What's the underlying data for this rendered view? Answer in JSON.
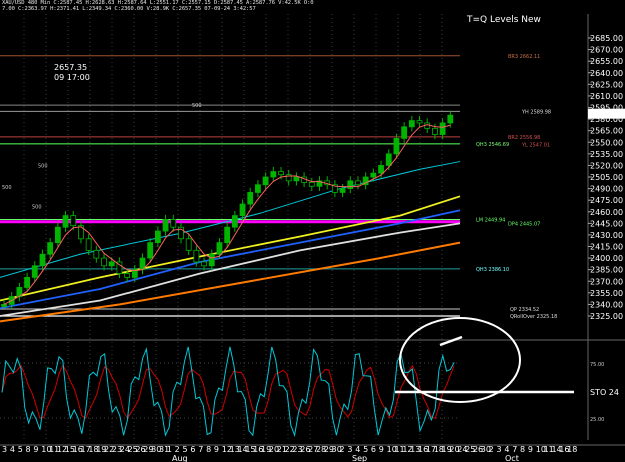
{
  "header": {
    "line1": "XAU/USD 480 Min  C:2587.45  H:2628.63  H:2587.64  L:2551.17  C:2557.15  D:2587.45  A:2587.76  V:42.5K  O:0",
    "line2": "7.00  C:2363.97  H:2371.41  L:2349.34  C:2360.00  V:28.9K  C:2657.35  07-09-24  3:42:57"
  },
  "chart_title": "T=Q Levels New",
  "info_box": {
    "price": "2657.35",
    "time": "09 17:00"
  },
  "current_price": "2587.41",
  "price_axis": [
    "2685.00",
    "2670.00",
    "2655.00",
    "2640.00",
    "2625.00",
    "2610.00",
    "2595.00",
    "2580.00",
    "2565.00",
    "2550.00",
    "2535.00",
    "2520.00",
    "2505.00",
    "2490.00",
    "2475.00",
    "2460.00",
    "2445.00",
    "2430.00",
    "2415.00",
    "2400.00",
    "2385.00",
    "2370.00",
    "2355.00",
    "2340.00",
    "2325.00"
  ],
  "level_labels": {
    "l1": "BR3 2662.11",
    "l2": "YH 2589.98",
    "l3": "BR2 2556.98",
    "l4": "QH3 2546.69",
    "l5": "YL 2547.01",
    "l6": "LM 2449.94",
    "l7": "DP4 2445.07",
    "l8": "QH3 2386.10",
    "l9": "QP 2334.52",
    "l10": "QRollOver 2325.18",
    "m500a": "500",
    "m500b": "500",
    "m500c": "500",
    "m500d": "500"
  },
  "oscillator": {
    "label": "STO  24",
    "ticks": [
      "75.00",
      "25.00"
    ]
  },
  "x_axis": {
    "days": [
      "3",
      "4",
      "5",
      "8",
      "9",
      "10",
      "11",
      "12",
      "15",
      "16",
      "17",
      "18",
      "19",
      "22",
      "23",
      "24",
      "25",
      "26",
      "29",
      "30",
      "31",
      "1",
      "2",
      "5",
      "6",
      "7",
      "8",
      "9",
      "12",
      "13",
      "14",
      "15",
      "16",
      "19",
      "20",
      "21",
      "22",
      "23",
      "26",
      "27",
      "28",
      "29",
      "30",
      "2",
      "3",
      "4",
      "5",
      "6",
      "9",
      "10",
      "11",
      "12",
      "13",
      "16",
      "17",
      "18",
      "19",
      "20",
      "24",
      "25",
      "26",
      "30",
      "2",
      "3",
      "4",
      "7",
      "8",
      "9",
      "10",
      "11",
      "14",
      "16",
      "18"
    ],
    "months": [
      "Aug",
      "Sep",
      "Oct"
    ]
  },
  "colors": {
    "bg": "#000000",
    "candle": "#00b400",
    "price_line": "#ff7000",
    "stoch_line": "#00c8d8",
    "stoch_red": "#d00000",
    "magenta": "#ff00ff"
  }
}
